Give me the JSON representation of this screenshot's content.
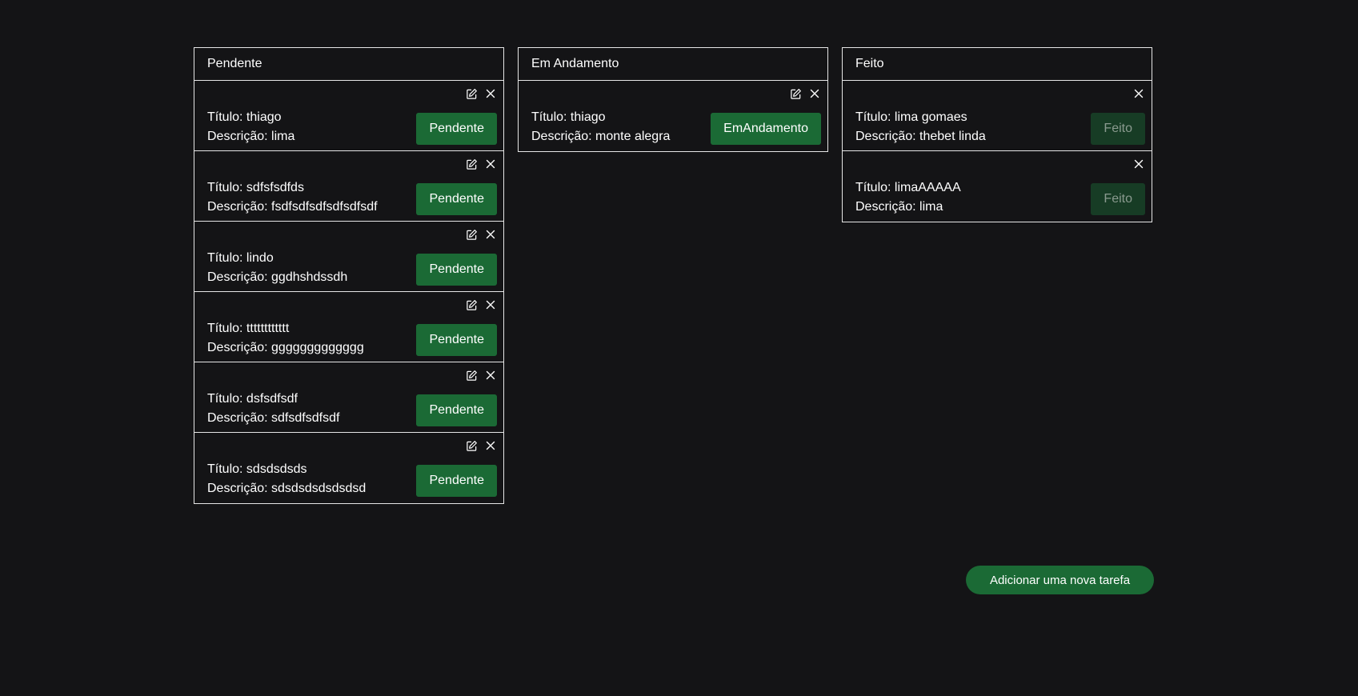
{
  "columns": [
    {
      "title": "Pendente",
      "cards": [
        {
          "titulo_label": "Título:",
          "titulo": "thiago",
          "descricao_label": "Descrição:",
          "descricao": "lima",
          "status": "Pendente",
          "editable": true
        },
        {
          "titulo_label": "Título:",
          "titulo": "sdfsfsdfds",
          "descricao_label": "Descrição:",
          "descricao": "fsdfsdfsdfsdfsdfsdf",
          "status": "Pendente",
          "editable": true
        },
        {
          "titulo_label": "Título:",
          "titulo": "lindo",
          "descricao_label": "Descrição:",
          "descricao": "ggdhshdssdh",
          "status": "Pendente",
          "editable": true
        },
        {
          "titulo_label": "Título:",
          "titulo": "tttttttttttt",
          "descricao_label": "Descrição:",
          "descricao": "ggggggggggggg",
          "status": "Pendente",
          "editable": true
        },
        {
          "titulo_label": "Título:",
          "titulo": "dsfsdfsdf",
          "descricao_label": "Descrição:",
          "descricao": "sdfsdfsdfsdf",
          "status": "Pendente",
          "editable": true
        },
        {
          "titulo_label": "Título:",
          "titulo": "sdsdsdsds",
          "descricao_label": "Descrição:",
          "descricao": "sdsdsdsdsdsdsd",
          "status": "Pendente",
          "editable": true
        }
      ]
    },
    {
      "title": "Em Andamento",
      "cards": [
        {
          "titulo_label": "Título:",
          "titulo": "thiago",
          "descricao_label": "Descrição:",
          "descricao": "monte alegra",
          "status": "EmAndamento",
          "editable": true
        }
      ]
    },
    {
      "title": "Feito",
      "cards": [
        {
          "titulo_label": "Título:",
          "titulo": "lima gomaes",
          "descricao_label": "Descrição:",
          "descricao": "thebet linda",
          "status": "Feito",
          "editable": false
        },
        {
          "titulo_label": "Título:",
          "titulo": "limaAAAAA",
          "descricao_label": "Descrição:",
          "descricao": "lima",
          "status": "Feito",
          "editable": false
        }
      ]
    }
  ],
  "add_task_label": "Adicionar uma nova tarefa",
  "icons": {
    "edit": "edit-icon",
    "close": "close-icon"
  },
  "colors": {
    "background": "#141416",
    "border": "#e6e6e6",
    "button_green": "#1b6a35",
    "button_done": "#173c25",
    "button_done_text": "#8a9a8f"
  }
}
